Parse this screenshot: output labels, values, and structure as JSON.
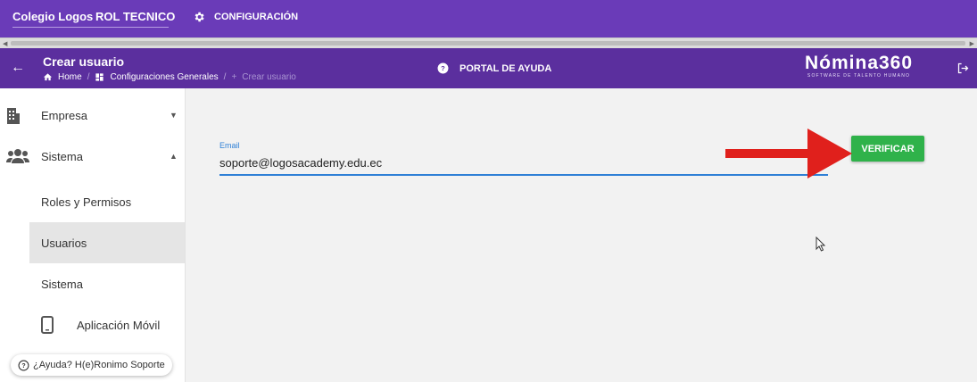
{
  "topbar": {
    "org_name": "Colegio Logos",
    "role": "ROL TECNICO",
    "config_label": "CONFIGURACIÓN"
  },
  "header": {
    "title": "Crear usuario",
    "breadcrumb": [
      "Home",
      "Configuraciones Generales",
      "Crear usuario"
    ],
    "help_portal": "PORTAL DE AYUDA",
    "brand": "Nómina360",
    "brand_tagline": "SOFTWARE DE TALENTO HUMANO"
  },
  "sidebar": {
    "items": [
      {
        "label": "Empresa",
        "icon": "building-icon",
        "caret": "▼"
      },
      {
        "label": "Sistema",
        "icon": "users-icon",
        "caret": "▲"
      }
    ],
    "sub_items": [
      {
        "label": "Roles y Permisos"
      },
      {
        "label": "Usuarios",
        "active": true
      },
      {
        "label": "Sistema"
      },
      {
        "label": "Aplicación Móvil",
        "icon": "mobile-icon"
      }
    ],
    "help_chip": "¿Ayuda? H(e)Ronimo Soporte"
  },
  "form": {
    "email_label": "Email",
    "email_value": "soporte@logosacademy.edu.ec",
    "verify_label": "VERIFICAR"
  },
  "colors": {
    "topbar": "#6a3bb8",
    "header": "#5b2f9e",
    "accent_blue": "#2f80d6",
    "verify_green": "#2fb24a",
    "annotation_red": "#e0201c"
  }
}
